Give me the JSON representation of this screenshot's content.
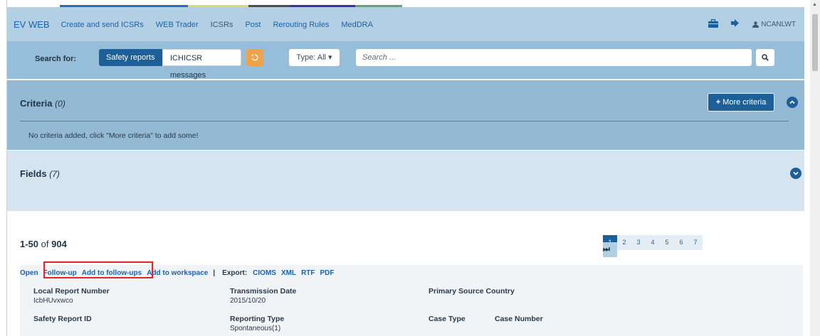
{
  "nav": {
    "brand": "EV WEB",
    "items": [
      {
        "label": "Create and send ICSRs"
      },
      {
        "label": "WEB Trader"
      },
      {
        "label": "ICSRs"
      },
      {
        "label": "Post"
      },
      {
        "label": "Rerouting Rules"
      },
      {
        "label": "MedDRA"
      }
    ],
    "user": "NCANLWT",
    "strip_colors": [
      "#2a6fb3",
      "#e6d56a",
      "#4d4d4d",
      "#3a2fa0",
      "#6aa17a"
    ]
  },
  "search": {
    "label": "Search for:",
    "toggle_safety": "Safety reports",
    "toggle_ichi": "ICHICSR messages",
    "type_label": "Type: All",
    "placeholder": "Search ..."
  },
  "criteria": {
    "title": "Criteria",
    "count": "(0)",
    "more_button": "More criteria",
    "empty_message": "No criteria added, click \"More criteria\" to add some!"
  },
  "fields": {
    "title": "Fields",
    "count": "(7)"
  },
  "results": {
    "range": "1-50",
    "of": "of",
    "total": "904",
    "actions": {
      "open": "Open",
      "follow_up": "Follow-up",
      "add_follow_ups": "Add to follow-ups",
      "add_workspace": "Add to workspace",
      "separator": "|",
      "export_label": "Export:",
      "cioms": "CIOMS",
      "xml": "XML",
      "rtf": "RTF",
      "pdf": "PDF"
    },
    "row": {
      "local_report_number_label": "Local Report Number",
      "local_report_number": "IcbHUvxwco",
      "transmission_date_label": "Transmission Date",
      "transmission_date": "2015/10/20",
      "primary_source_country_label": "Primary Source Country",
      "safety_report_id_label": "Safety Report ID",
      "reporting_type_label": "Reporting Type",
      "reporting_type": "Spontaneous(1)",
      "case_type_label": "Case Type",
      "case_number_label": "Case Number"
    }
  },
  "pagination": {
    "pages": [
      "1",
      "2",
      "3",
      "4",
      "5",
      "6",
      "7"
    ],
    "current": "1"
  },
  "colors": {
    "accent": "#1d5f97",
    "highlight": "#e0252b",
    "reset": "#f0a24a"
  }
}
